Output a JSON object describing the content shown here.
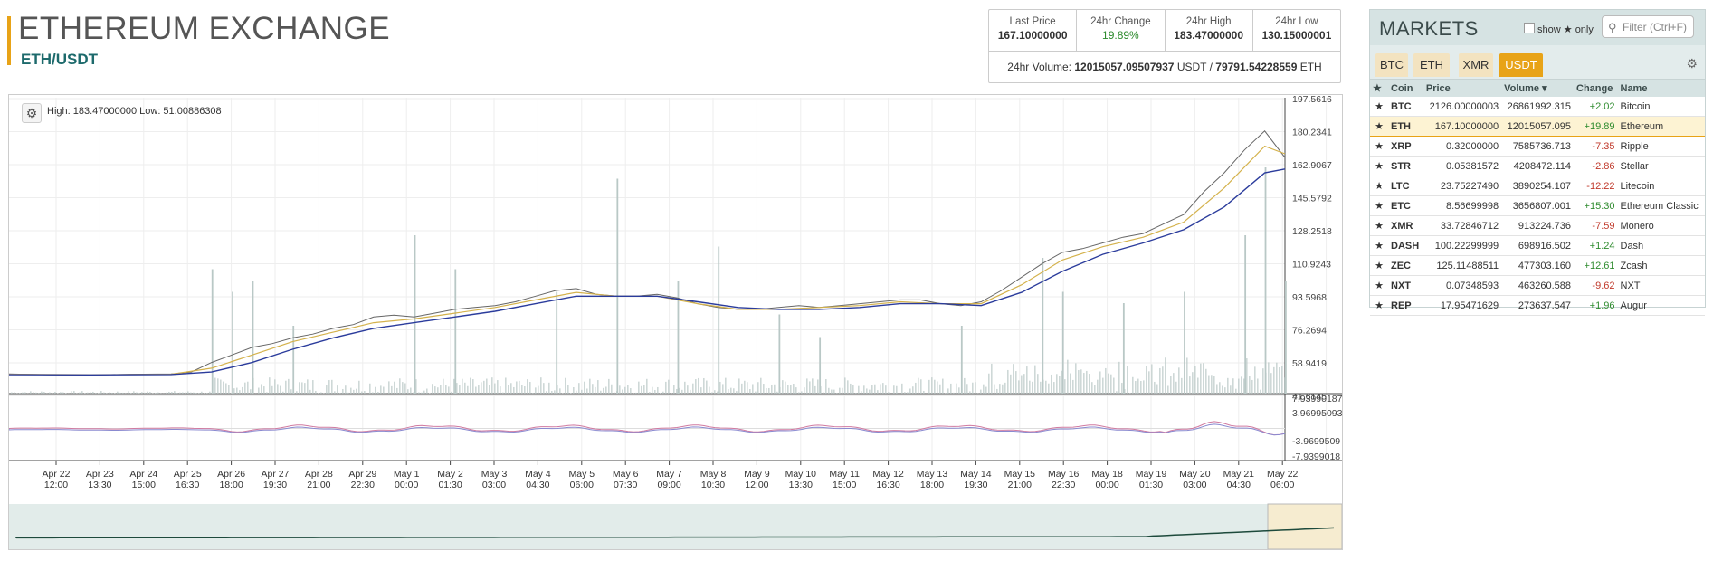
{
  "header": {
    "title": "ETHEREUM EXCHANGE",
    "pair": "ETH/USDT"
  },
  "stats": [
    {
      "label": "Last Price",
      "value": "167.10000000",
      "color": "#333333"
    },
    {
      "label": "24hr Change",
      "value": "19.89%",
      "color": "#2e8b2e"
    },
    {
      "label": "24hr High",
      "value": "183.47000000",
      "color": "#333333"
    },
    {
      "label": "24hr Low",
      "value": "130.15000001",
      "color": "#333333"
    }
  ],
  "volume": {
    "prefix": "24hr Volume:",
    "usdt_value": "12015057.09507937",
    "usdt_unit": "USDT /",
    "eth_value": "79791.54228559",
    "eth_unit": "ETH"
  },
  "chart": {
    "settings_icon": "gear-icon",
    "hilo_text": "High: 183.47000000   Low: 51.00886308",
    "price_axis": [
      "197.5616",
      "180.2341",
      "162.9067",
      "145.5792",
      "128.2518",
      "110.9243",
      "93.5968",
      "76.2694",
      "58.9419",
      "41.6145"
    ],
    "macd_axis": [
      "7.93990187",
      "3.96995093",
      "-3.9699509",
      "-7.9399018"
    ],
    "time_axis": [
      [
        "Apr 22",
        "12:00"
      ],
      [
        "Apr 23",
        "13:30"
      ],
      [
        "Apr 24",
        "15:00"
      ],
      [
        "Apr 25",
        "16:30"
      ],
      [
        "Apr 26",
        "18:00"
      ],
      [
        "Apr 27",
        "19:30"
      ],
      [
        "Apr 28",
        "21:00"
      ],
      [
        "Apr 29",
        "22:30"
      ],
      [
        "May 1",
        "00:00"
      ],
      [
        "May 2",
        "01:30"
      ],
      [
        "May 3",
        "03:00"
      ],
      [
        "May 4",
        "04:30"
      ],
      [
        "May 5",
        "06:00"
      ],
      [
        "May 6",
        "07:30"
      ],
      [
        "May 7",
        "09:00"
      ],
      [
        "May 8",
        "10:30"
      ],
      [
        "May 9",
        "12:00"
      ],
      [
        "May 10",
        "13:30"
      ],
      [
        "May 11",
        "15:00"
      ],
      [
        "May 12",
        "16:30"
      ],
      [
        "May 13",
        "18:00"
      ],
      [
        "May 14",
        "19:30"
      ],
      [
        "May 15",
        "21:00"
      ],
      [
        "May 16",
        "22:30"
      ],
      [
        "May 18",
        "00:00"
      ],
      [
        "May 19",
        "01:30"
      ],
      [
        "May 20",
        "03:00"
      ],
      [
        "May 21",
        "04:30"
      ],
      [
        "May 22",
        "06:00"
      ]
    ]
  },
  "chart_data": {
    "type": "line",
    "y_range": [
      41.6145,
      197.5616
    ],
    "price": [
      [
        0,
        52
      ],
      [
        2,
        51.5
      ],
      [
        4,
        51.4
      ],
      [
        6,
        51.8
      ],
      [
        8,
        52
      ],
      [
        9,
        53
      ],
      [
        10,
        58
      ],
      [
        11,
        62
      ],
      [
        12,
        66
      ],
      [
        13,
        68
      ],
      [
        14,
        71
      ],
      [
        15,
        73
      ],
      [
        16,
        76
      ],
      [
        17,
        78
      ],
      [
        18,
        82
      ],
      [
        19,
        83
      ],
      [
        20,
        82
      ],
      [
        21,
        84
      ],
      [
        22,
        86
      ],
      [
        23,
        87
      ],
      [
        24,
        88
      ],
      [
        25,
        90
      ],
      [
        26,
        93
      ],
      [
        27,
        96
      ],
      [
        28,
        97
      ],
      [
        29,
        94
      ],
      [
        30,
        93
      ],
      [
        31,
        93
      ],
      [
        32,
        94
      ],
      [
        33,
        92
      ],
      [
        34,
        89
      ],
      [
        35,
        87
      ],
      [
        36,
        86
      ],
      [
        37,
        86
      ],
      [
        38,
        87
      ],
      [
        39,
        88
      ],
      [
        40,
        87
      ],
      [
        41,
        88
      ],
      [
        42,
        89
      ],
      [
        43,
        90
      ],
      [
        44,
        91
      ],
      [
        45,
        91
      ],
      [
        46,
        89
      ],
      [
        47,
        88
      ],
      [
        48,
        90
      ],
      [
        49,
        96
      ],
      [
        50,
        103
      ],
      [
        51,
        110
      ],
      [
        52,
        116
      ],
      [
        53,
        118
      ],
      [
        54,
        121
      ],
      [
        55,
        124
      ],
      [
        56,
        126
      ],
      [
        57,
        131
      ],
      [
        58,
        136
      ],
      [
        59,
        148
      ],
      [
        60,
        158
      ],
      [
        61,
        170
      ],
      [
        62,
        180
      ],
      [
        63,
        166
      ]
    ],
    "ma_fast": [
      [
        0,
        51.8
      ],
      [
        4,
        51.6
      ],
      [
        8,
        51.8
      ],
      [
        10,
        55
      ],
      [
        12,
        62
      ],
      [
        14,
        69
      ],
      [
        16,
        74
      ],
      [
        18,
        79
      ],
      [
        20,
        81
      ],
      [
        22,
        84
      ],
      [
        24,
        87
      ],
      [
        26,
        91
      ],
      [
        28,
        95
      ],
      [
        30,
        93
      ],
      [
        32,
        93
      ],
      [
        34,
        89
      ],
      [
        36,
        86
      ],
      [
        38,
        86
      ],
      [
        40,
        87
      ],
      [
        42,
        88
      ],
      [
        44,
        90
      ],
      [
        46,
        89
      ],
      [
        48,
        89
      ],
      [
        50,
        99
      ],
      [
        52,
        112
      ],
      [
        54,
        119
      ],
      [
        56,
        124
      ],
      [
        58,
        132
      ],
      [
        60,
        150
      ],
      [
        62,
        172
      ],
      [
        63,
        168
      ]
    ],
    "ma_slow": [
      [
        0,
        51.6
      ],
      [
        4,
        51.5
      ],
      [
        8,
        51.7
      ],
      [
        10,
        53
      ],
      [
        12,
        58
      ],
      [
        14,
        65
      ],
      [
        16,
        71
      ],
      [
        18,
        76
      ],
      [
        20,
        79
      ],
      [
        22,
        82
      ],
      [
        24,
        85
      ],
      [
        26,
        89
      ],
      [
        28,
        93
      ],
      [
        30,
        93
      ],
      [
        32,
        93
      ],
      [
        34,
        90
      ],
      [
        36,
        87
      ],
      [
        38,
        86
      ],
      [
        40,
        86
      ],
      [
        42,
        87
      ],
      [
        44,
        89
      ],
      [
        46,
        89
      ],
      [
        48,
        88
      ],
      [
        50,
        95
      ],
      [
        52,
        106
      ],
      [
        54,
        115
      ],
      [
        56,
        121
      ],
      [
        58,
        128
      ],
      [
        60,
        140
      ],
      [
        62,
        158
      ],
      [
        63,
        160
      ]
    ],
    "volume_spikes": [
      [
        10,
        0.55
      ],
      [
        11,
        0.45
      ],
      [
        12,
        0.5
      ],
      [
        14,
        0.3
      ],
      [
        20,
        0.7
      ],
      [
        22,
        0.55
      ],
      [
        27,
        0.45
      ],
      [
        30,
        0.95
      ],
      [
        33,
        0.5
      ],
      [
        35,
        0.65
      ],
      [
        38,
        0.35
      ],
      [
        40,
        0.25
      ],
      [
        47,
        0.3
      ],
      [
        51,
        0.6
      ],
      [
        52,
        0.45
      ],
      [
        55,
        0.4
      ],
      [
        58,
        0.45
      ],
      [
        61,
        0.7
      ],
      [
        62,
        1.0
      ],
      [
        63,
        0.5
      ]
    ]
  },
  "markets": {
    "title": "MARKETS",
    "show_label": "show",
    "only_label": "only",
    "filter_placeholder": "Filter (Ctrl+F)",
    "tabs": [
      "BTC",
      "ETH",
      "XMR",
      "USDT"
    ],
    "active_tab": "USDT",
    "columns": [
      "Coin",
      "Price",
      "Volume ▾",
      "Change",
      "Name"
    ],
    "rows": [
      {
        "coin": "BTC",
        "price": "2126.00000003",
        "volume": "26861992.315",
        "change": "+2.02",
        "name": "Bitcoin",
        "selected": false
      },
      {
        "coin": "ETH",
        "price": "167.10000000",
        "volume": "12015057.095",
        "change": "+19.89",
        "name": "Ethereum",
        "selected": true
      },
      {
        "coin": "XRP",
        "price": "0.32000000",
        "volume": "7585736.713",
        "change": "-7.35",
        "name": "Ripple",
        "selected": false
      },
      {
        "coin": "STR",
        "price": "0.05381572",
        "volume": "4208472.114",
        "change": "-2.86",
        "name": "Stellar",
        "selected": false
      },
      {
        "coin": "LTC",
        "price": "23.75227490",
        "volume": "3890254.107",
        "change": "-12.22",
        "name": "Litecoin",
        "selected": false
      },
      {
        "coin": "ETC",
        "price": "8.56699998",
        "volume": "3656807.001",
        "change": "+15.30",
        "name": "Ethereum Classic",
        "selected": false
      },
      {
        "coin": "XMR",
        "price": "33.72846712",
        "volume": "913224.736",
        "change": "-7.59",
        "name": "Monero",
        "selected": false
      },
      {
        "coin": "DASH",
        "price": "100.22299999",
        "volume": "698916.502",
        "change": "+1.24",
        "name": "Dash",
        "selected": false
      },
      {
        "coin": "ZEC",
        "price": "125.11488511",
        "volume": "477303.160",
        "change": "+12.61",
        "name": "Zcash",
        "selected": false
      },
      {
        "coin": "NXT",
        "price": "0.07348593",
        "volume": "463260.588",
        "change": "-9.62",
        "name": "NXT",
        "selected": false
      },
      {
        "coin": "REP",
        "price": "17.95471629",
        "volume": "273637.547",
        "change": "+1.96",
        "name": "Augur",
        "selected": false
      }
    ]
  },
  "colors": {
    "accent": "#e8a317",
    "pair": "#1d6a6c",
    "positive": "#2e8b2e",
    "negative": "#c0392b",
    "ma_slow": "#2b3c9c",
    "ma_fast": "#d4b24c",
    "volume": "#b9c8c6"
  }
}
